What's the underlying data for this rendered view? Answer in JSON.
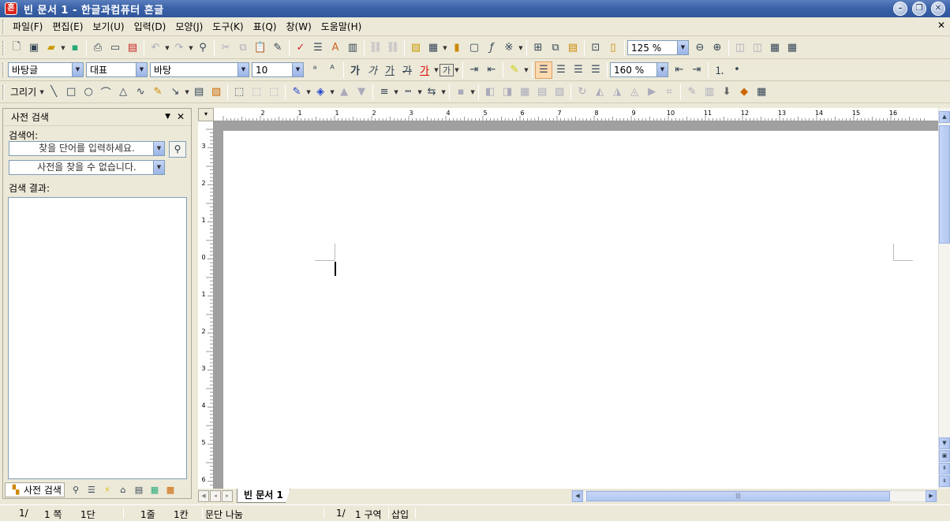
{
  "window": {
    "title": "빈 문서 1 - 한글과컴퓨터 흔글",
    "app_icon": "흔"
  },
  "menu": [
    {
      "label": "파일(F)"
    },
    {
      "label": "편집(E)"
    },
    {
      "label": "보기(U)"
    },
    {
      "label": "입력(D)"
    },
    {
      "label": "모양(J)"
    },
    {
      "label": "도구(K)"
    },
    {
      "label": "표(Q)"
    },
    {
      "label": "창(W)"
    },
    {
      "label": "도움말(H)"
    }
  ],
  "toolbar1": {
    "zoom": "125 %"
  },
  "toolbar2": {
    "style": "바탕글",
    "font_lang": "대표",
    "font": "바탕",
    "size": "10",
    "line_spacing": "160 %",
    "bold": "가",
    "italic": "가",
    "underline": "가",
    "strike": "가",
    "color": "가",
    "char": "가"
  },
  "toolbar3": {
    "draw_label": "그리기"
  },
  "side_panel": {
    "title": "사전 검색",
    "search_label": "검색어:",
    "search_placeholder": "찾을 단어를 입력하세요.",
    "dict_select": "사전을 찾을 수 없습니다.",
    "results_label": "검색 결과:",
    "tab_label": "사전 검색"
  },
  "ruler": {
    "h_ticks": [
      "2",
      "1",
      "1",
      "2",
      "3",
      "4",
      "5",
      "6",
      "7",
      "8",
      "9",
      "10",
      "11",
      "12",
      "13",
      "14",
      "15",
      "16"
    ],
    "v_ticks": [
      "3",
      "2",
      "1",
      "0",
      "1",
      "2",
      "3",
      "4",
      "5",
      "6"
    ]
  },
  "document": {
    "tab_label": "빈 문서 1"
  },
  "status": {
    "page": "1/",
    "page_label": "1 쪽",
    "section": "1단",
    "line": "1줄",
    "column": "1칸",
    "paragraph": "문단 나눔",
    "section_of": "1/",
    "area": "1 구역",
    "mode": "삽입"
  }
}
